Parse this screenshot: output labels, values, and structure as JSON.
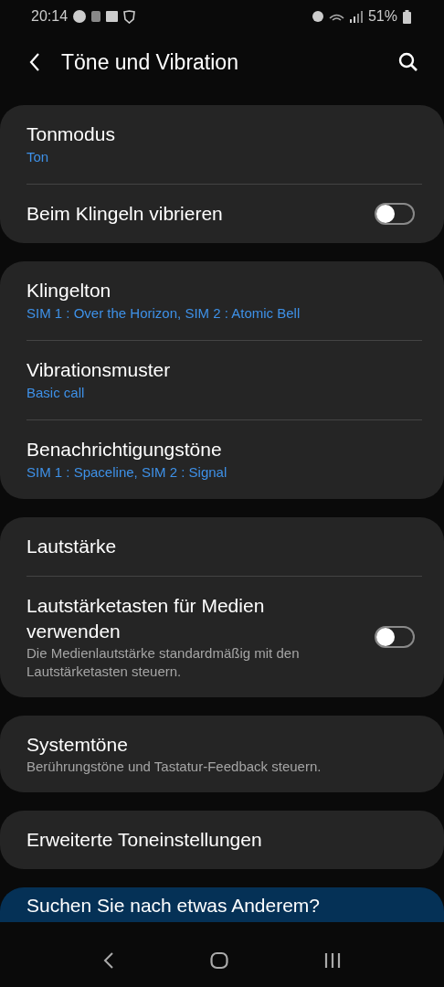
{
  "status_bar": {
    "time": "20:14",
    "battery": "51%"
  },
  "header": {
    "title": "Töne und Vibration"
  },
  "groups": [
    {
      "items": [
        {
          "kind": "nav",
          "title": "Tonmodus",
          "value": "Ton"
        },
        {
          "kind": "switch",
          "title": "Beim Klingeln vibrieren",
          "on": false
        }
      ]
    },
    {
      "items": [
        {
          "kind": "nav",
          "title": "Klingelton",
          "value": "SIM 1 : Over the Horizon, SIM 2 : Atomic Bell"
        },
        {
          "kind": "nav",
          "title": "Vibrationsmuster",
          "value": "Basic call"
        },
        {
          "kind": "nav",
          "title": "Benachrichtigungstöne",
          "value": "SIM 1 : Spaceline, SIM 2 : Signal"
        }
      ]
    },
    {
      "items": [
        {
          "kind": "nav",
          "title": "Lautstärke"
        },
        {
          "kind": "switch",
          "title": "Lautstärketasten für Medien verwenden",
          "description": "Die Medienlautstärke standardmäßig mit den Lautstärketasten steuern.",
          "on": false
        }
      ]
    },
    {
      "items": [
        {
          "kind": "nav",
          "title": "Systemtöne",
          "description": "Berührungstöne und Tastatur-Feedback steuern."
        }
      ]
    },
    {
      "items": [
        {
          "kind": "nav",
          "title": "Erweiterte Toneinstellungen"
        }
      ]
    }
  ],
  "suggestion": {
    "title": "Suchen Sie nach etwas Anderem?"
  }
}
